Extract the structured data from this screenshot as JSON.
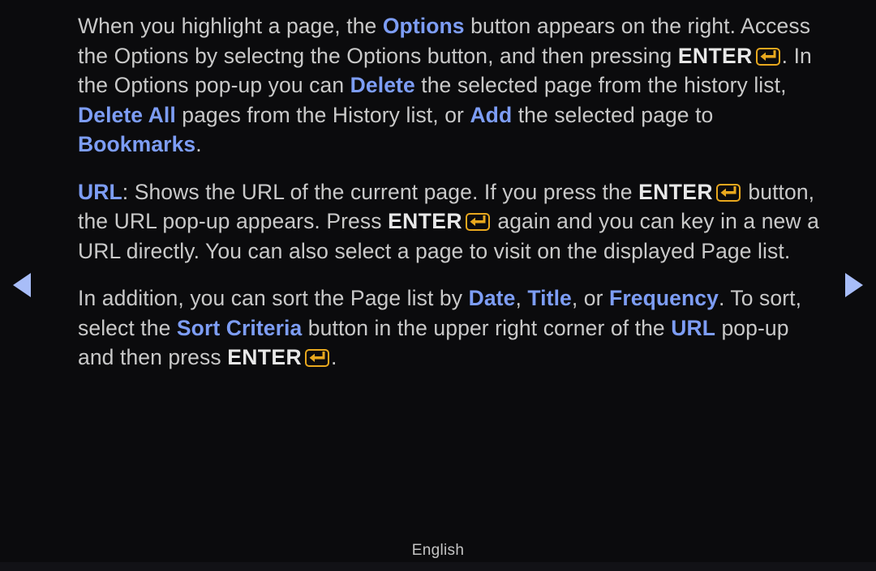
{
  "screen": {
    "background_color": "#0b0b0d",
    "text_color": "#c9c9c9",
    "keyword_color": "#7d9df5",
    "enter_icon_color": "#e8a81e",
    "arrow_color": "#a8bdf8"
  },
  "paragraphs": [
    {
      "id": "options-paragraph",
      "segments": [
        {
          "type": "text",
          "value": "When you highlight a page, the "
        },
        {
          "type": "keyword",
          "value": "Options"
        },
        {
          "type": "text",
          "value": " button appears on the right. Access the Options by selectng the Options button, and then pressing "
        },
        {
          "type": "strong",
          "value": "ENTER"
        },
        {
          "type": "enter-icon",
          "value": "enter-key-icon"
        },
        {
          "type": "text",
          "value": ". In the Options pop-up you can "
        },
        {
          "type": "keyword",
          "value": "Delete"
        },
        {
          "type": "text",
          "value": " the selected page from the history list, "
        },
        {
          "type": "keyword",
          "value": "Delete All"
        },
        {
          "type": "text",
          "value": " pages from the History list, or "
        },
        {
          "type": "keyword",
          "value": "Add"
        },
        {
          "type": "text",
          "value": " the selected page to "
        },
        {
          "type": "keyword",
          "value": "Bookmarks"
        },
        {
          "type": "text",
          "value": "."
        }
      ]
    },
    {
      "id": "url-paragraph",
      "segments": [
        {
          "type": "keyword",
          "value": "URL"
        },
        {
          "type": "text",
          "value": ": Shows the URL of the current page. If you press the "
        },
        {
          "type": "strong",
          "value": "ENTER"
        },
        {
          "type": "enter-icon",
          "value": "enter-key-icon"
        },
        {
          "type": "text",
          "value": " button, the URL pop-up appears. Press "
        },
        {
          "type": "strong",
          "value": "ENTER"
        },
        {
          "type": "enter-icon",
          "value": "enter-key-icon"
        },
        {
          "type": "text",
          "value": " again and you can key in a new a URL directly. You can also select a page to visit on the displayed Page list."
        }
      ]
    },
    {
      "id": "sort-paragraph",
      "segments": [
        {
          "type": "text",
          "value": "In addition, you can sort the Page list by "
        },
        {
          "type": "keyword",
          "value": "Date"
        },
        {
          "type": "text",
          "value": ", "
        },
        {
          "type": "keyword",
          "value": "Title"
        },
        {
          "type": "text",
          "value": ", or "
        },
        {
          "type": "keyword",
          "value": "Frequency"
        },
        {
          "type": "text",
          "value": ". To sort, select the "
        },
        {
          "type": "keyword",
          "value": "Sort Criteria"
        },
        {
          "type": "text",
          "value": " button in the upper right corner of the "
        },
        {
          "type": "keyword",
          "value": "URL"
        },
        {
          "type": "text",
          "value": " pop-up and then press "
        },
        {
          "type": "strong",
          "value": "ENTER"
        },
        {
          "type": "enter-icon",
          "value": "enter-key-icon"
        },
        {
          "type": "text",
          "value": "."
        }
      ]
    }
  ],
  "navigation": {
    "prev_label": "previous-page-arrow",
    "next_label": "next-page-arrow"
  },
  "footer": {
    "language": "English"
  }
}
